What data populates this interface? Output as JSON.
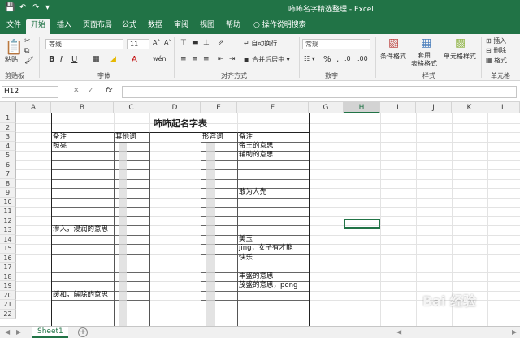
{
  "window": {
    "title": "咘咘名字精选整理 - Excel"
  },
  "quick_access": {
    "save_icon": "save-icon",
    "undo_icon": "undo-icon",
    "redo_icon": "redo-icon"
  },
  "tabs": [
    "文件",
    "开始",
    "插入",
    "页面布局",
    "公式",
    "数据",
    "审阅",
    "视图",
    "帮助"
  ],
  "tell_me": "操作说明搜索",
  "ribbon": {
    "clipboard": {
      "paste": "粘贴",
      "label": "剪贴板"
    },
    "font": {
      "name": "等线",
      "size": "11",
      "label": "字体"
    },
    "alignment": {
      "wrap": "自动换行",
      "merge": "合并后居中",
      "label": "对齐方式"
    },
    "number": {
      "format": "常规",
      "label": "数字"
    },
    "styles": {
      "conditional": "条件格式",
      "table": "套用\n表格格式",
      "cell_styles": "单元格样式",
      "label": "样式"
    },
    "cells": {
      "insert": "插入",
      "delete": "删除",
      "format": "格式",
      "label": "单元格"
    }
  },
  "name_box": "H12",
  "columns": [
    "A",
    "B",
    "C",
    "D",
    "E",
    "F",
    "G",
    "H",
    "I",
    "J",
    "K",
    "L"
  ],
  "selected_column": "H",
  "rows": [
    "1",
    "2",
    "3",
    "4",
    "5",
    "6",
    "7",
    "8",
    "9",
    "10",
    "11",
    "12",
    "13",
    "14",
    "15",
    "16",
    "17",
    "18",
    "19",
    "20",
    "21",
    "22"
  ],
  "sheet": {
    "title": "咘咘起名字表",
    "headers": {
      "b": "备注",
      "c": "其他词",
      "e": "形容词",
      "f": "备注"
    },
    "b_notes": [
      {
        "row": 4,
        "text": "照亮"
      },
      {
        "row": 13,
        "text": "滲入，浸润的意思"
      },
      {
        "row": 20,
        "text": "缓和，解除的意思"
      }
    ],
    "f_notes": [
      {
        "row": 4,
        "text": "帝王的意思"
      },
      {
        "row": 5,
        "text": "辅助的意思"
      },
      {
        "row": 9,
        "text": "敢为人先"
      },
      {
        "row": 14,
        "text": "美玉"
      },
      {
        "row": 15,
        "text": "jing，女子有才能"
      },
      {
        "row": 16,
        "text": "快乐"
      },
      {
        "row": 18,
        "text": "丰盛的意思"
      },
      {
        "row": 19,
        "text": "茂盛的意思，peng"
      }
    ]
  },
  "sheet_tabs": [
    "Sheet1"
  ],
  "watermark": "Bai 经验"
}
